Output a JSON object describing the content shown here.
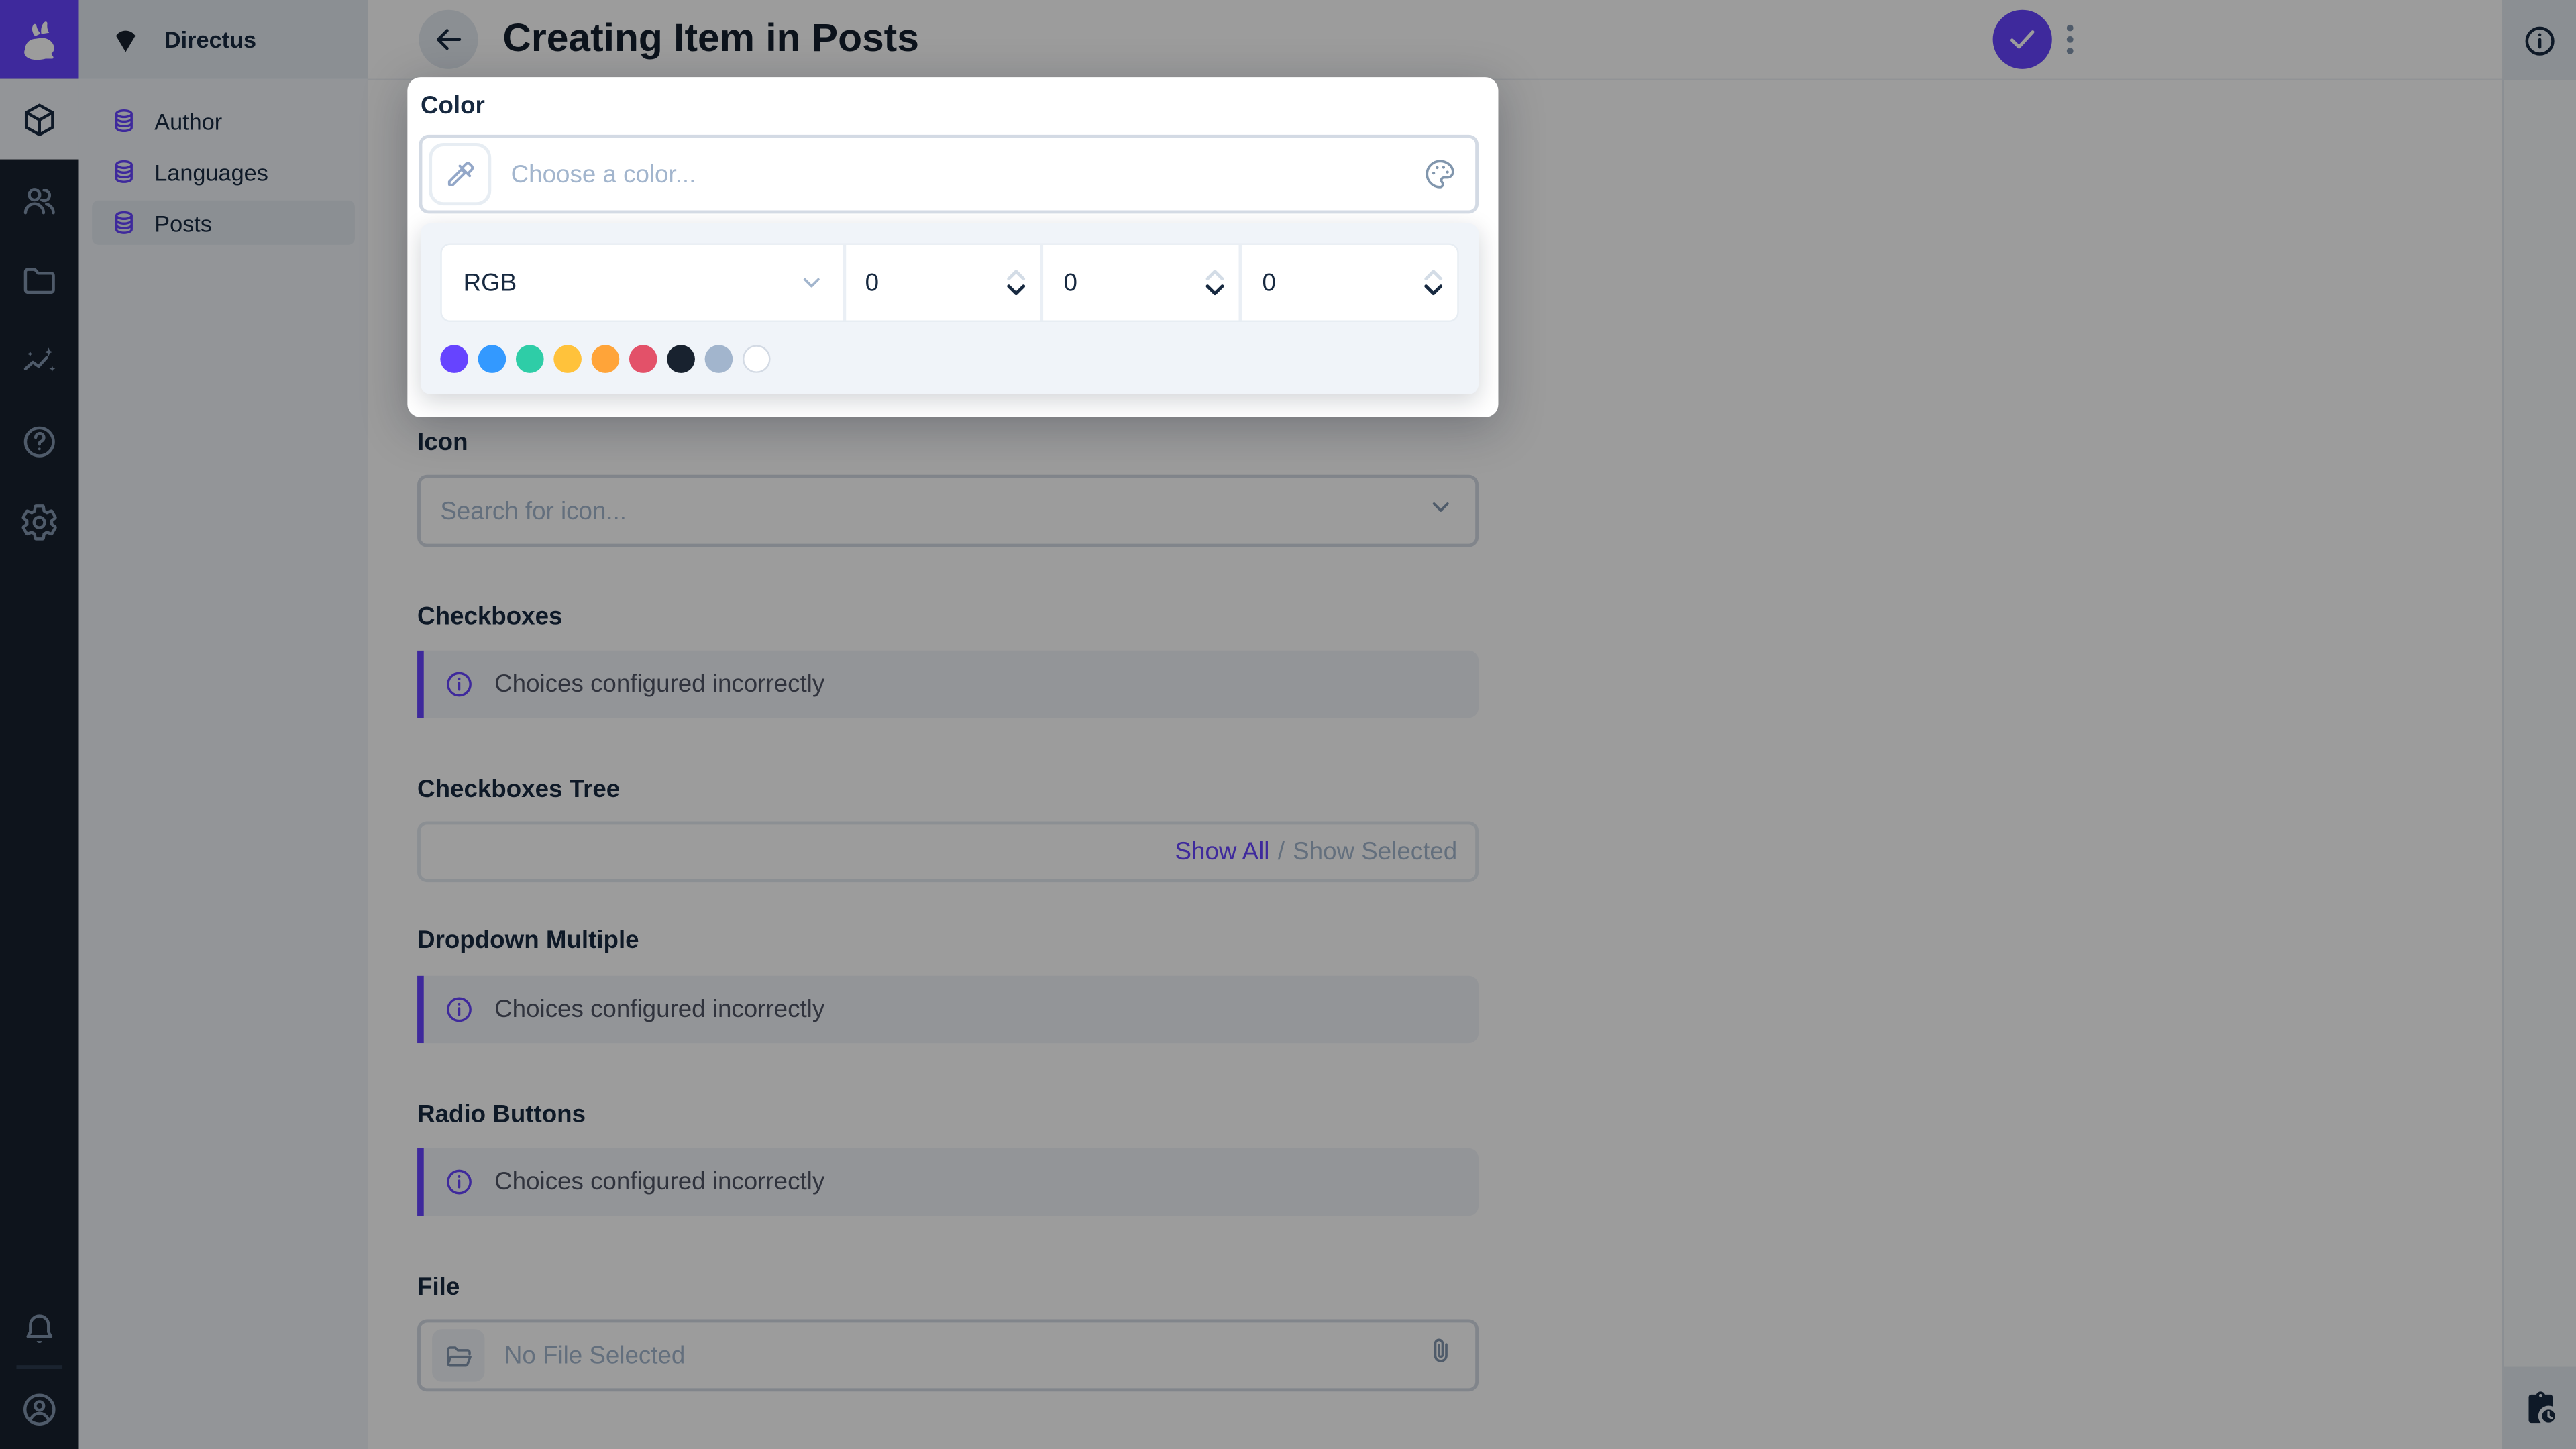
{
  "app": {
    "title": "Creating Item in Posts",
    "accent_color": "#6644FF",
    "module_bar_color": "#18222F",
    "nav_background": "#F0F4F9",
    "overlay_color": "rgba(0,0,0,0.39)"
  },
  "module_bar": {
    "logo_icon": "rabbit-logo-icon",
    "items": [
      {
        "icon": "content-module-cube-icon",
        "active": true
      },
      {
        "icon": "user-directory-icon",
        "active": false
      },
      {
        "icon": "file-library-icon",
        "active": false
      },
      {
        "icon": "insights-icon",
        "active": false
      },
      {
        "icon": "help-docs-icon",
        "active": false
      },
      {
        "icon": "settings-gear-icon",
        "active": false
      }
    ],
    "bottom_items": [
      {
        "icon": "notifications-bell-icon"
      },
      {
        "icon": "account-avatar-icon"
      }
    ]
  },
  "nav": {
    "project_name": "Directus",
    "project_icon": "fan-logo-icon",
    "items": [
      {
        "icon": "database-icon",
        "label": "Author",
        "active": false
      },
      {
        "icon": "database-icon",
        "label": "Languages",
        "active": false
      },
      {
        "icon": "database-icon",
        "label": "Posts",
        "active": true
      }
    ]
  },
  "header": {
    "back_icon": "arrow-left-icon",
    "title": "Creating Item in Posts",
    "save_icon": "check-icon",
    "more_icon": "more-vertical-icon",
    "info_icon": "info-circle-icon"
  },
  "right_sidebar": {
    "top_icon": "info-circle-icon",
    "bottom_icon": "clipboard-clock-icon"
  },
  "popup": {
    "field_label": "Color",
    "input": {
      "placeholder": "Choose a color...",
      "value": ""
    },
    "eyedropper_icon": "eyedropper-icon",
    "palette_icon": "palette-icon",
    "mode": "RGB",
    "channels": [
      "0",
      "0",
      "0"
    ],
    "swatches": [
      {
        "hex": "#6644FF"
      },
      {
        "hex": "#3399FF"
      },
      {
        "hex": "#2ECDA7"
      },
      {
        "hex": "#FFC23B"
      },
      {
        "hex": "#FFA439"
      },
      {
        "hex": "#E35169"
      },
      {
        "hex": "#18222F"
      },
      {
        "hex": "#A2B5CD"
      },
      {
        "hex": "#FFFFFF",
        "border": "#D3DAE4"
      }
    ]
  },
  "form": {
    "fields": [
      {
        "label": "Icon",
        "placeholder": "Search for icon...",
        "trailing_icon": "chevron-down-icon"
      },
      {
        "label": "Checkboxes",
        "notice": "Choices configured incorrectly",
        "notice_icon": "info-circle-icon"
      },
      {
        "label": "Checkboxes Tree",
        "show_all": "Show All",
        "separator": "/",
        "show_selected": "Show Selected"
      },
      {
        "label": "Dropdown Multiple",
        "notice": "Choices configured incorrectly",
        "notice_icon": "info-circle-icon"
      },
      {
        "label": "Radio Buttons",
        "notice": "Choices configured incorrectly",
        "notice_icon": "info-circle-icon"
      },
      {
        "label": "File",
        "placeholder": "No File Selected",
        "leading_icon": "folder-open-icon",
        "trailing_icon": "paperclip-icon"
      }
    ]
  }
}
